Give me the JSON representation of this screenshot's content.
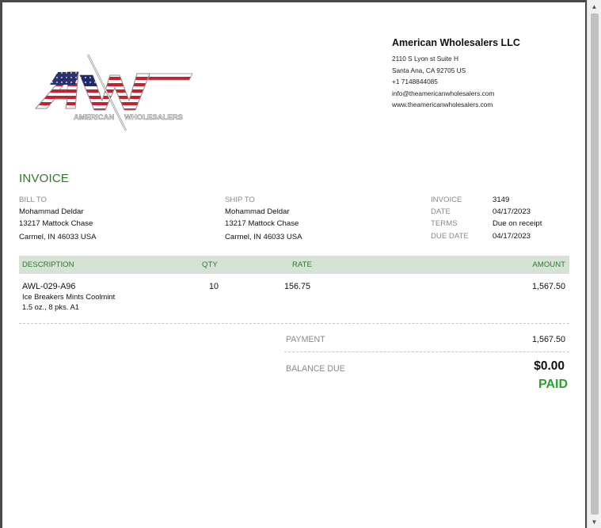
{
  "company": {
    "name": "American Wholesalers LLC",
    "address_line1": "2110 S Lyon st Suite H",
    "address_line2": "Santa Ana, CA  92705 US",
    "phone": "+1 7148844085",
    "email": "info@theamericanwholesalers.com",
    "website": "www.theamericanwholesalers.com",
    "logo_text": "AW",
    "logo_tagline_left": "AMERICAN",
    "logo_tagline_right": "WHOLESALERS"
  },
  "document": {
    "heading": "INVOICE"
  },
  "bill_to": {
    "label": "BILL TO",
    "name": "Mohammad Deldar",
    "street": "13217 Mattock Chase",
    "city": "Carmel, IN  46033 USA"
  },
  "ship_to": {
    "label": "SHIP TO",
    "name": "Mohammad Deldar",
    "street": "13217 Mattock Chase",
    "city": "Carmel, IN  46033 USA"
  },
  "meta": [
    {
      "key": "INVOICE",
      "value": "3149"
    },
    {
      "key": "DATE",
      "value": "04/17/2023"
    },
    {
      "key": "TERMS",
      "value": "Due on receipt"
    },
    {
      "key": "DUE DATE",
      "value": "04/17/2023"
    }
  ],
  "table": {
    "headers": {
      "description": "DESCRIPTION",
      "qty": "QTY",
      "rate": "RATE",
      "amount": "AMOUNT"
    },
    "rows": [
      {
        "sku": "AWL-029-A96",
        "name": "Ice Breakers Mints Coolmint",
        "detail": "1.5 oz., 8 pks. A1",
        "qty": "10",
        "rate": "156.75",
        "amount": "1,567.50"
      }
    ]
  },
  "totals": {
    "payment_label": "PAYMENT",
    "payment_value": "1,567.50",
    "balance_label": "BALANCE DUE",
    "balance_value": "$0.00",
    "status": "PAID"
  },
  "colors": {
    "accent_green": "#2c7a2c",
    "paid_green": "#2ea02e",
    "header_bg": "#d6e2d6",
    "flag_red": "#c8202f",
    "flag_blue": "#1f2a6b"
  },
  "icons": {
    "scroll_up": "▲",
    "scroll_down": "▼"
  }
}
